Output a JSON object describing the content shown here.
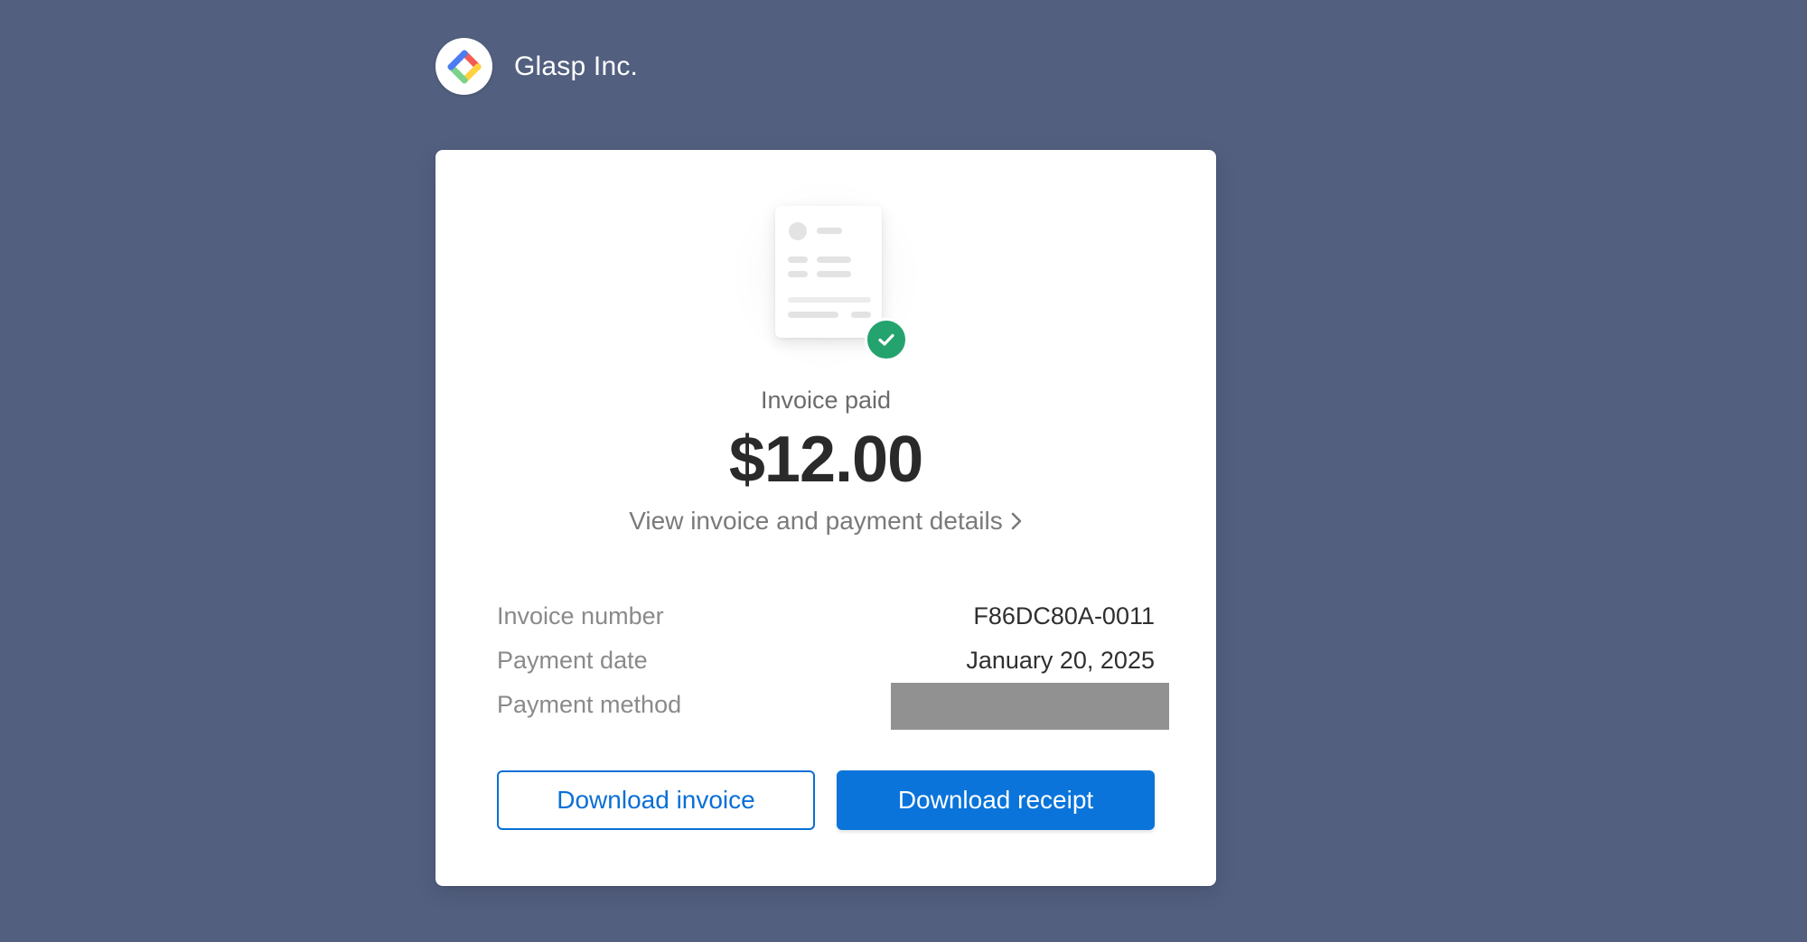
{
  "brand": {
    "name": "Glasp Inc.",
    "logo_icon": "glasp-logo-icon"
  },
  "invoice": {
    "status_text": "Invoice paid",
    "amount": "$12.00",
    "details_link": "View invoice and payment details",
    "status_icon": "check-circle-icon",
    "details": [
      {
        "label": "Invoice number",
        "value": "F86DC80A-0011"
      },
      {
        "label": "Payment date",
        "value": "January 20, 2025"
      },
      {
        "label": "Payment method",
        "value": ""
      }
    ]
  },
  "actions": {
    "download_invoice": "Download invoice",
    "download_receipt": "Download receipt"
  },
  "colors": {
    "page_background": "#525f7f",
    "accent": "#0a74da",
    "success": "#24a36f",
    "redaction": "#919191"
  }
}
